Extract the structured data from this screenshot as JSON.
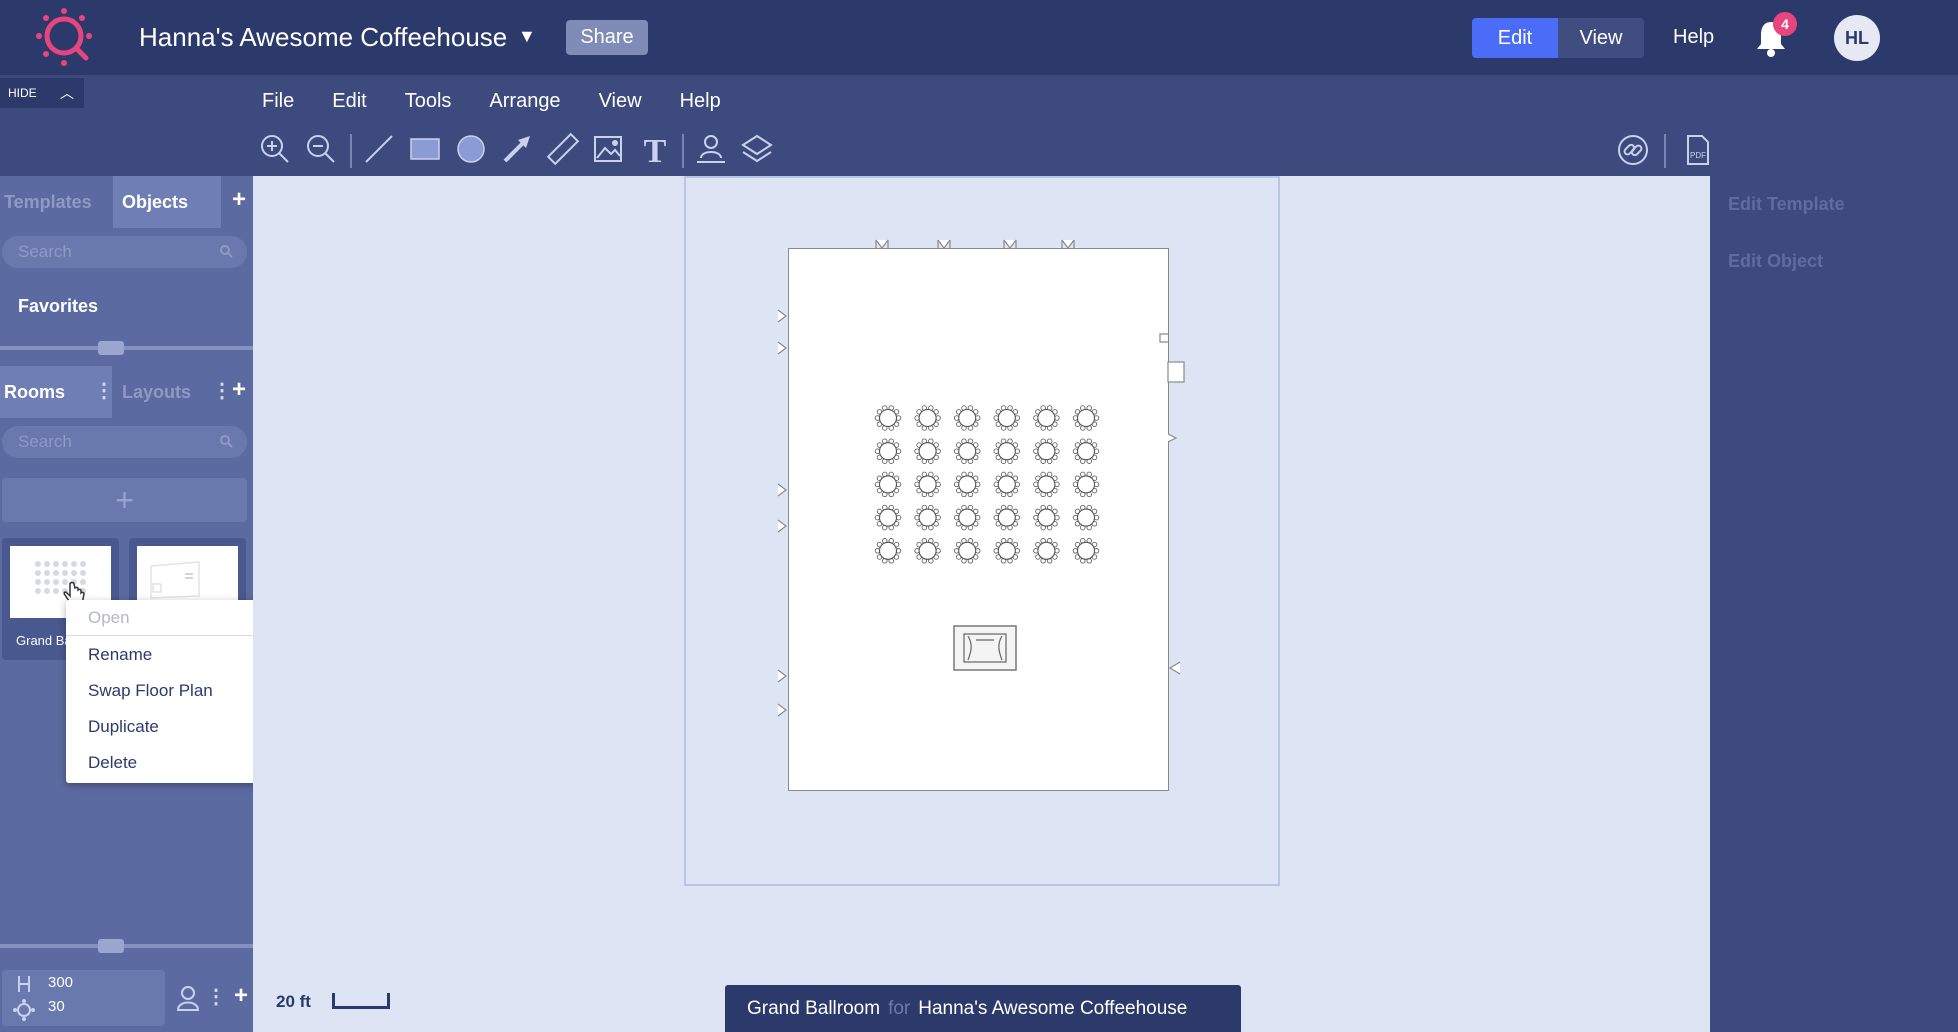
{
  "header": {
    "project_title": "Hanna's Awesome Coffeehouse",
    "share_label": "Share",
    "modes": [
      "Edit",
      "View"
    ],
    "active_mode": "Edit",
    "help_label": "Help",
    "notification_count": "4",
    "avatar_initials": "HL",
    "logo_color": "#e8457f"
  },
  "sidebar": {
    "hide_label": "HIDE",
    "top_tabs": [
      "Templates",
      "Objects"
    ],
    "active_top_tab": "Objects",
    "search_placeholder": "Search",
    "favorites_label": "Favorites",
    "bottom_tabs": [
      "Rooms",
      "Layouts"
    ],
    "active_bottom_tab": "Rooms",
    "rooms_search_placeholder": "Search",
    "room_label": "Grand Ba",
    "stats": {
      "capacity": "300",
      "seated": "30"
    }
  },
  "menu": {
    "items": [
      "File",
      "Edit",
      "Tools",
      "Arrange",
      "View",
      "Help"
    ]
  },
  "toolbar": {
    "tools": [
      "zoom-in-icon",
      "zoom-out-icon",
      "line-icon",
      "rectangle-icon",
      "circle-icon",
      "arrow-icon",
      "ruler-icon",
      "image-icon",
      "text-icon",
      "person-pin-icon",
      "layers-icon"
    ],
    "right_tools": [
      "link-icon",
      "pdf-icon"
    ]
  },
  "context_menu": {
    "items": [
      "Open",
      "Rename",
      "Swap Floor Plan",
      "Duplicate",
      "Delete"
    ],
    "disabled": [
      "Open"
    ]
  },
  "canvas": {
    "scale_label": "20 ft",
    "table_rows": 5,
    "table_cols": 6
  },
  "footer": {
    "room_name": "Grand Ballroom",
    "for_label": "for",
    "venue_name": "Hanna's Awesome Coffeehouse"
  },
  "right_panel": {
    "links": [
      "Edit Template",
      "Edit Object"
    ]
  }
}
